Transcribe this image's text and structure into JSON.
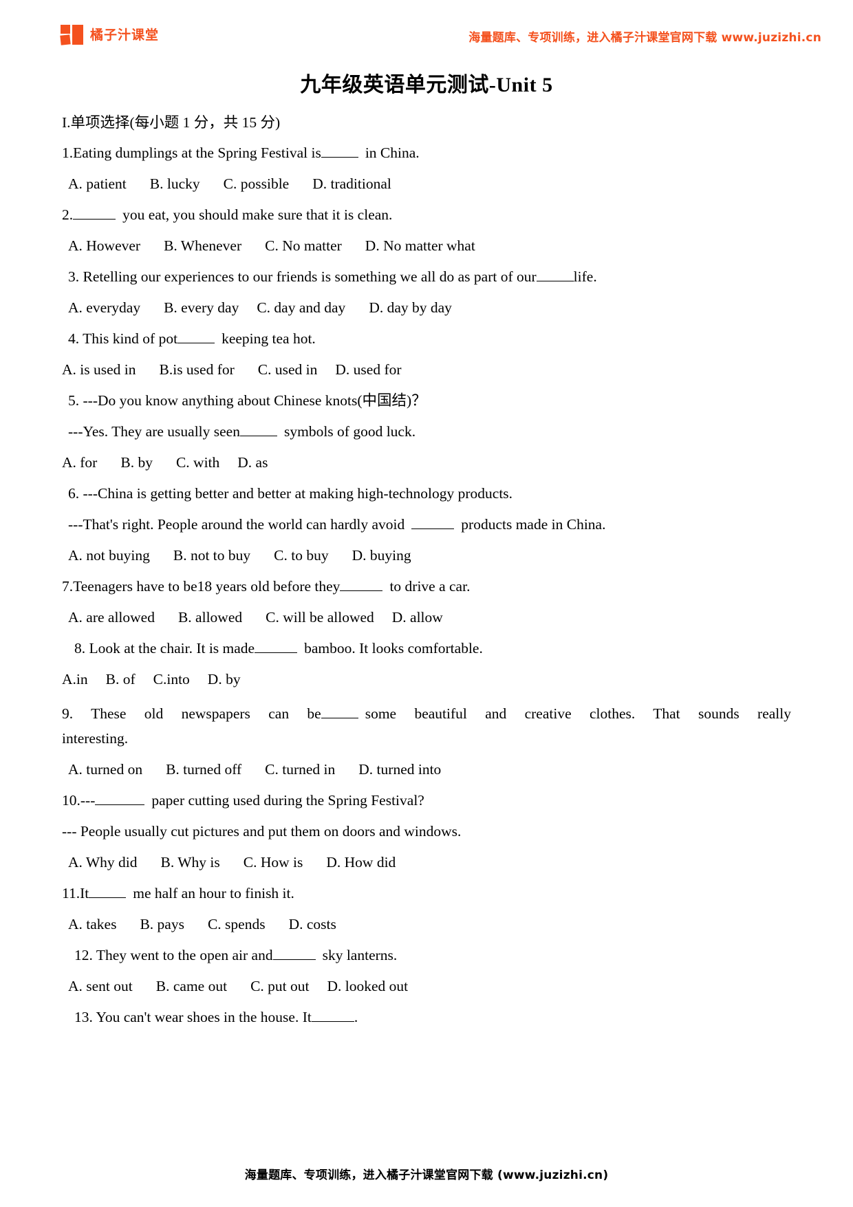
{
  "header": {
    "brand_name": "橘子汁课堂",
    "promo": "海量题库、专项训练，进入橘子汁课堂官网下载 www.juzizhi.cn"
  },
  "document": {
    "title": "九年级英语单元测试-Unit 5",
    "section_heading": "I.单项选择(每小题 1 分，共 15 分)"
  },
  "questions": [
    {
      "number": "1.",
      "stem_before": "1.Eating dumplings at the Spring Festival is",
      "stem_after": "in China.",
      "options_line": "A. patient        B. lucky        C. possible        D. traditional",
      "opt_a": "A. patient",
      "opt_b": "B. lucky",
      "opt_c": "C. possible",
      "opt_d": "D. traditional"
    },
    {
      "number": "2.",
      "stem_before": "2.",
      "stem_after": "you eat, you should make sure that it is clean.",
      "opt_a": "A. However",
      "opt_b": "B. Whenever",
      "opt_c": "C. No matter",
      "opt_d": "D. No matter what"
    },
    {
      "number": "3.",
      "stem_before": "3. Retelling our experiences to our friends is something we all do as part of our",
      "stem_after": "life.",
      "opt_a": "A. everyday",
      "opt_b": "B. every day",
      "opt_c": "C. day and day",
      "opt_d": "D. day by day"
    },
    {
      "number": "4.",
      "stem_before": "4. This kind of pot",
      "stem_after": "keeping tea hot.",
      "opt_a": "A. is used in",
      "opt_b": "B.is used for",
      "opt_c": "C. used in",
      "opt_d": "D. used for"
    },
    {
      "number": "5.",
      "stem_line1": "5. ---Do you know anything about Chinese knots(中国结)？",
      "stem_before": "---Yes. They are usually seen",
      "stem_after": "symbols of good luck.",
      "opt_a": "A. for",
      "opt_b": "B. by",
      "opt_c": "C. with",
      "opt_d": "D. as"
    },
    {
      "number": "6.",
      "stem_line1": "6. ---China is getting better and better at making high-technology products.",
      "stem_before": "---That's right. People around the world can hardly avoid",
      "stem_after": "products made in China.",
      "opt_a": "A. not buying",
      "opt_b": "B. not to buy",
      "opt_c": "C. to buy",
      "opt_d": "D. buying"
    },
    {
      "number": "7.",
      "stem_before": "7.Teenagers have to be18 years old before they",
      "stem_after": "to drive a car.",
      "opt_a": "A. are allowed",
      "opt_b": "B. allowed",
      "opt_c": "C. will be allowed",
      "opt_d": "D. allow"
    },
    {
      "number": "8.",
      "stem_before": "8. Look at the chair. It is made",
      "stem_after": "bamboo. It looks comfortable.",
      "opt_a": "A.in",
      "opt_b": "B. of",
      "opt_c": "C.into",
      "opt_d": "D. by"
    },
    {
      "number": "9.",
      "stem_before": "9. These old newspapers can be",
      "stem_after": "some beautiful and creative clothes. That sounds really",
      "stem_cont": "interesting.",
      "opt_a": "A. turned on",
      "opt_b": "B. turned off",
      "opt_c": "C. turned in",
      "opt_d": "D. turned into"
    },
    {
      "number": "10.",
      "stem_before": "10.---",
      "stem_after": "paper cutting used during the Spring Festival?",
      "stem_line2": "--- People usually cut pictures and put them on doors and windows.",
      "opt_a": "A. Why did",
      "opt_b": "B. Why is",
      "opt_c": "C. How is",
      "opt_d": "D. How did"
    },
    {
      "number": "11.",
      "stem_before": "11.It",
      "stem_after": "me half an hour to finish it.",
      "opt_a": "A. takes",
      "opt_b": "B. pays",
      "opt_c": "C. spends",
      "opt_d": "D. costs"
    },
    {
      "number": "12.",
      "stem_before": "12. They went to the open air and",
      "stem_after": "sky lanterns.",
      "opt_a": "A. sent out",
      "opt_b": "B. came out",
      "opt_c": "C. put out",
      "opt_d": "D. looked out"
    },
    {
      "number": "13.",
      "stem_before": "13. You can't wear shoes in the house. It",
      "stem_after": "."
    }
  ],
  "footer": {
    "text": "海量题库、专项训练，进入橘子汁课堂官网下载 (www.juzizhi.cn)"
  },
  "colors": {
    "brand_orange": "#f4511e",
    "text_black": "#000000",
    "page_background": "#ffffff"
  }
}
